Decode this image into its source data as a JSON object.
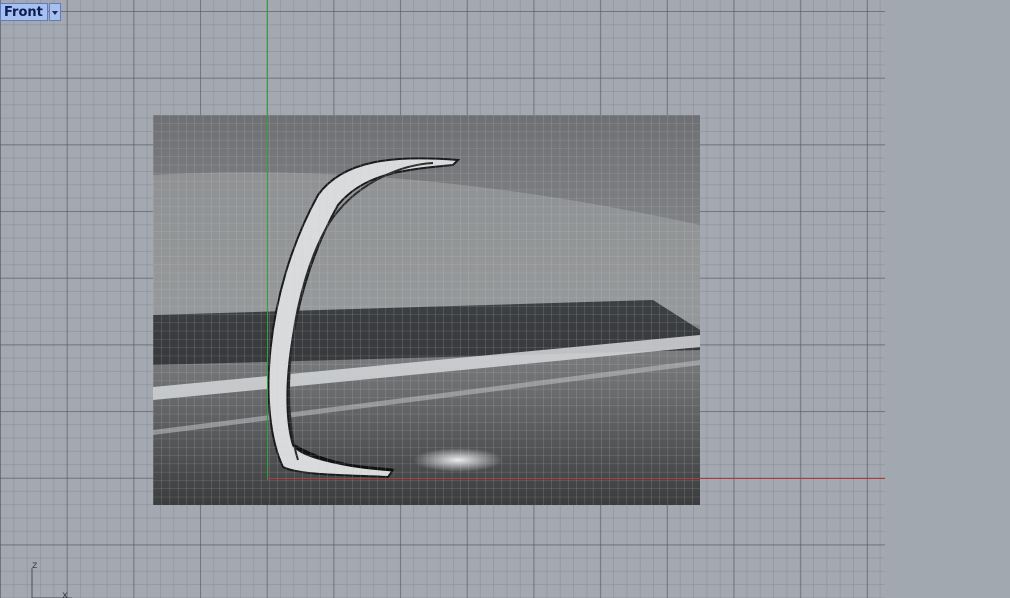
{
  "viewport": {
    "label": "Front",
    "menu_icon": "dropdown-arrow-icon",
    "background_image": "curved-arch-sculpture-photo",
    "axis_colors": {
      "x": "#b33a3a",
      "y": "#2ea339"
    },
    "gizmo": {
      "z_label": "z",
      "x_label": "x"
    }
  }
}
